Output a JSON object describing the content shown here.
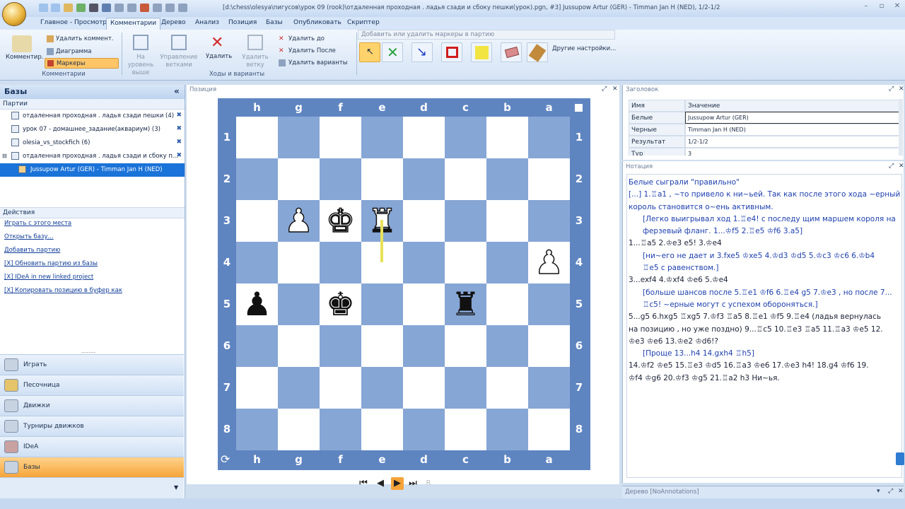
{
  "window": {
    "title": "[d:\\chess\\olesya\\пигусов\\урок 09 (rook)\\отдаленная проходная . ладья сзади и сбоку пешки(урок).pgn, #3] Jussupow Artur (GER) - Timman Jan H (NED), 1/2-1/2"
  },
  "tabs": [
    "Главное - Просмотр",
    "Комментарии",
    "Дерево",
    "Анализ",
    "Позиция",
    "Базы",
    "Опубликовать",
    "Скриптер"
  ],
  "ribbon": {
    "comment_btn": "Комментир.",
    "delete_comment": "Удалить коммент.",
    "diagram": "Диаграмма",
    "markers": "Маркеры",
    "group_comments": "Комментарии",
    "to_top_level": "На уровень выше",
    "manage_branches": "Управление ветками",
    "delete": "Удалить",
    "delete_branch": "Удалить ветку",
    "delete_before": "Удалить до",
    "delete_after": "Удалить После",
    "delete_variations": "Удалить варианты",
    "group_moves": "Ходы и варианты",
    "marker_tooltip": "Добавить или удалить маркеры в партию",
    "other_settings": "Другие настройки..."
  },
  "left": {
    "header": "Базы",
    "games_label": "Партии",
    "games": [
      "отдаленная проходная . ладья сзади пешки (4)",
      "урок 07 - домашнее_задание(аквариум) (3)",
      "olesia_vs_stockfich (6)",
      "отдаленная проходная . ладья сзади и сбоку п...",
      "Jussupow Artur (GER) - Timman Jan H (NED)"
    ],
    "actions_label": "Действия",
    "actions": [
      "Играть с этого места",
      "Открыть базу...",
      "Добавить партию",
      "[X] Обновить партию из базы",
      "[X] IDeA in new linked project",
      "[X] Копировать позицию в буфер как"
    ],
    "nav": [
      "Играть",
      "Песочница",
      "Движки",
      "Турниры движков",
      "IDeA",
      "Базы"
    ]
  },
  "board": {
    "panel_label": "Позиция",
    "files": [
      "h",
      "g",
      "f",
      "e",
      "d",
      "c",
      "b",
      "a"
    ],
    "ranks": [
      "1",
      "2",
      "3",
      "4",
      "5",
      "6",
      "7",
      "8"
    ],
    "pieces": [
      {
        "square": "g3",
        "glyph": "♟",
        "color": "w"
      },
      {
        "square": "f3",
        "glyph": "♚",
        "color": "w"
      },
      {
        "square": "e3",
        "glyph": "♜",
        "color": "w"
      },
      {
        "square": "a4",
        "glyph": "♟",
        "color": "w"
      },
      {
        "square": "h5",
        "glyph": "♟",
        "color": "b"
      },
      {
        "square": "f5",
        "glyph": "♚",
        "color": "b"
      },
      {
        "square": "c5",
        "glyph": "♜",
        "color": "b"
      }
    ]
  },
  "header_panel": {
    "label": "Заголовок",
    "col_name": "Имя",
    "col_value": "Значение",
    "rows": [
      {
        "k": "Белые",
        "v": "Jussupow Artur (GER)"
      },
      {
        "k": "Черные",
        "v": "Timman Jan H (NED)"
      },
      {
        "k": "Результат",
        "v": "1/2-1/2"
      },
      {
        "k": "Тур",
        "v": "3"
      }
    ]
  },
  "notation": {
    "label": "Нотация",
    "lines": [
      {
        "t": "Белые сыграли \"правильно\"",
        "c": "comment"
      },
      {
        "t": "[...] 1.♖a1 , ~то привело к ни~ьей. Так как после этого хода ~ерный",
        "c": "comment"
      },
      {
        "t": "король становится о~ень активным.",
        "c": "comment"
      },
      {
        "t": "[Легко выигрывал ход 1.♖e4! с последу щим маршем короля на",
        "c": "var"
      },
      {
        "t": "ферзевый фланг. 1...♔f5 2.♖e5 ♔f6 3.a5]",
        "c": "var"
      },
      {
        "t": "1...♖a5 2.♔e3 e5! 3.♔e4",
        "c": "main"
      },
      {
        "t": "[ни~его не дает и 3.fxe5 ♔xe5 4.♔d3 ♔d5 5.♔c3 ♔c6 6.♔b4",
        "c": "var"
      },
      {
        "t": "♖e5  с равенством.]",
        "c": "var"
      },
      {
        "t": "3...exf4 4.♔xf4 ♔e6 5.♔e4",
        "c": "main"
      },
      {
        "t": "[больше шансов после 5.♖e1 ♔f6 6.♖e4 g5 7.♔e3 , но после 7...",
        "c": "var"
      },
      {
        "t": "♖c5! ~ерные могут с успехом обороняться.]",
        "c": "var"
      },
      {
        "t": "5...g5 6.hxg5 ♖xg5 7.♔f3 ♖a5 8.♖e1 ♔f5 9.♖e4 (ладья вернулась",
        "c": "main"
      },
      {
        "t": "на позицию , но уже поздно) 9...♖c5 10.♖e3 ♖a5 11.♖a3 ♔e5 12.",
        "c": "main"
      },
      {
        "t": "♔e3 ♔e6 13.♔e2 ♔d6!?",
        "c": "main"
      },
      {
        "t": "[Проще 13...h4 14.gxh4 ♖h5]",
        "c": "var"
      },
      {
        "t": "14.♔f2 ♔e5 15.♖e3 ♔d5 16.♖a3 ♔e6 17.♔e3 h4! 18.g4 ♔f6 19.",
        "c": "main"
      },
      {
        "t": "♔f4 ♔g6 20.♔f3 ♔g5 21.♖a2 h3 Ни~ья.",
        "c": "main"
      }
    ]
  },
  "tree_bar": "Дерево [NoAnnotations]",
  "colors": {
    "accent": "#1a73d8",
    "board_dark": "#86a6d5",
    "board_frame": "#5f85c1",
    "highlight": "#f6a43a"
  }
}
